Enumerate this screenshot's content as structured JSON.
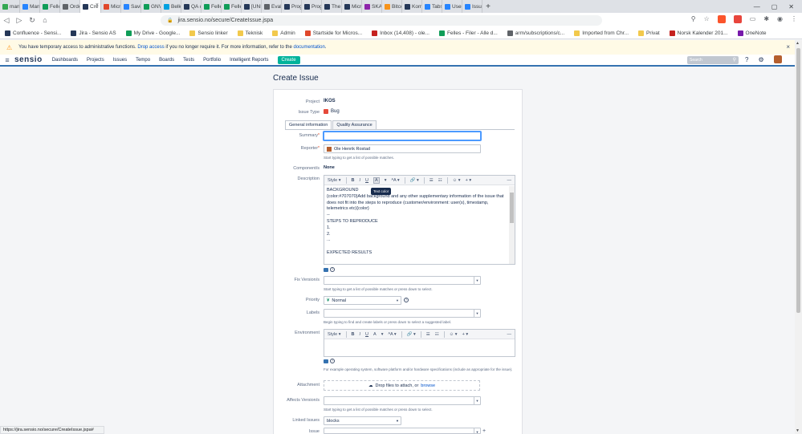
{
  "browser": {
    "tabs": [
      {
        "label": "mangi",
        "color": "#34a853"
      },
      {
        "label": "Manag",
        "color": "#2684ff"
      },
      {
        "label": "Felles",
        "color": "#0f9d58"
      },
      {
        "label": "Order",
        "color": "#5f6368"
      },
      {
        "label": "Cre",
        "color": "#253858",
        "active": true
      },
      {
        "label": "Micro",
        "color": "#e0482c"
      },
      {
        "label": "Saving",
        "color": "#2684ff"
      },
      {
        "label": "GNVP",
        "color": "#0f9d58"
      },
      {
        "label": "Belkin",
        "color": "#00a1e0"
      },
      {
        "label": "QA da",
        "color": "#253858"
      },
      {
        "label": "Felles",
        "color": "#0f9d58"
      },
      {
        "label": "Felles",
        "color": "#0f9d58"
      },
      {
        "label": "[UNI-S",
        "color": "#253858"
      },
      {
        "label": "Evaluz",
        "color": "#5f6368"
      },
      {
        "label": "Progra",
        "color": "#253858"
      },
      {
        "label": "Progra",
        "color": "#253858"
      },
      {
        "label": "The 30",
        "color": "#253858"
      },
      {
        "label": "Micro",
        "color": "#253858"
      },
      {
        "label": "SKATT",
        "color": "#8e24aa"
      },
      {
        "label": "Bitcoin",
        "color": "#f7931a"
      },
      {
        "label": "Kompo",
        "color": "#253858"
      },
      {
        "label": "Tabs D",
        "color": "#2684ff"
      },
      {
        "label": "User F",
        "color": "#2684ff"
      },
      {
        "label": "Issue N",
        "color": "#2684ff"
      }
    ],
    "url": "jira.sensio.no/secure/CreateIssue.jspa",
    "bookmarks": [
      {
        "label": "Confluence - Sensi...",
        "color": "#253858"
      },
      {
        "label": "Jira - Sensio AS",
        "color": "#253858"
      },
      {
        "label": "My Drive - Google...",
        "color": "#0f9d58"
      },
      {
        "label": "Sensio linker",
        "color": "#f2c94c"
      },
      {
        "label": "Teknisk",
        "color": "#f2c94c"
      },
      {
        "label": "Admin",
        "color": "#f2c94c"
      },
      {
        "label": "Startside for Micros...",
        "color": "#e0482c"
      },
      {
        "label": "Inbox (14,408) - ole...",
        "color": "#c5221f"
      },
      {
        "label": "Felles - Filer - Alle d...",
        "color": "#0f9d58"
      },
      {
        "label": "arm/subscriptions/c...",
        "color": "#5f6368"
      },
      {
        "label": "Imported from Chr...",
        "color": "#f2c94c"
      },
      {
        "label": "Privat",
        "color": "#f2c94c"
      },
      {
        "label": "Norsk Kalender 201...",
        "color": "#c5221f"
      },
      {
        "label": "OneNote",
        "color": "#7719aa"
      }
    ],
    "status_url": "https://jira.sensio.no/secure/CreateIssue.jspa#"
  },
  "banner": {
    "text1": "You have temporary access to administrative functions.",
    "link1": "Drop access",
    "text2": "if you no longer require it. For more information, refer to the",
    "link2": "documentation",
    "text3": "."
  },
  "jira": {
    "logo": "sensio",
    "nav": [
      "Dashboards",
      "Projects",
      "Issues",
      "Tempo",
      "Boards",
      "Tests",
      "Portfolio",
      "Intelligent Reports"
    ],
    "create_label": "Create",
    "search_placeholder": "Search"
  },
  "form": {
    "title": "Create Issue",
    "project_label": "Project",
    "project_value": "IKOS",
    "issuetype_label": "Issue Type",
    "issuetype_value": "Bug",
    "tabs": [
      "General information",
      "Quality Assurance"
    ],
    "summary_label": "Summary",
    "reporter_label": "Reporter",
    "reporter_value": "Ole Henrik Rostad",
    "reporter_help": "Start typing to get a list of possible matches.",
    "components_label": "Component/s",
    "components_value": "None",
    "description_label": "Description",
    "toolbar": {
      "style": "Style",
      "bold": "B",
      "italic": "I",
      "underline": "U",
      "color": "A",
      "size": "ᴬA",
      "link": "🔗",
      "bullets": "☰",
      "numbers": "☷",
      "emoji": "☺",
      "plus": "+"
    },
    "tooltip": "Text color",
    "description_lines": [
      "BACKGROUND",
      "{color:#707070}Add background  and any other supplementary information of the issue that",
      "does not fit into the steps to reproduce (customer/environment: user(s), timestamp,",
      "telemetrics etc){color}",
      "--",
      "STEPS TO REPRODUCE",
      "1.",
      "2.",
      "...",
      "",
      "EXPECTED RESULTS"
    ],
    "fixversion_label": "Fix Version/s",
    "fixversion_help": "Start typing to get a list of possible matches or press down to select.",
    "priority_label": "Priority",
    "priority_value": "Normal",
    "labels_label": "Labels",
    "labels_help": "Begin typing to find and create labels or press down to select a suggested label.",
    "environment_label": "Environment",
    "environment_help": "For example operating system, software platform and/or hardware specifications (include as appropriate for the issue).",
    "attachment_label": "Attachment",
    "attachment_text": "Drop files to attach, or",
    "attachment_link": "browse",
    "affects_label": "Affects Version/s",
    "affects_help": "Start typing to get a list of possible matches or press down to select.",
    "linked_label": "Linked Issues",
    "linked_value": "blocks",
    "issue_label": "Issue"
  }
}
